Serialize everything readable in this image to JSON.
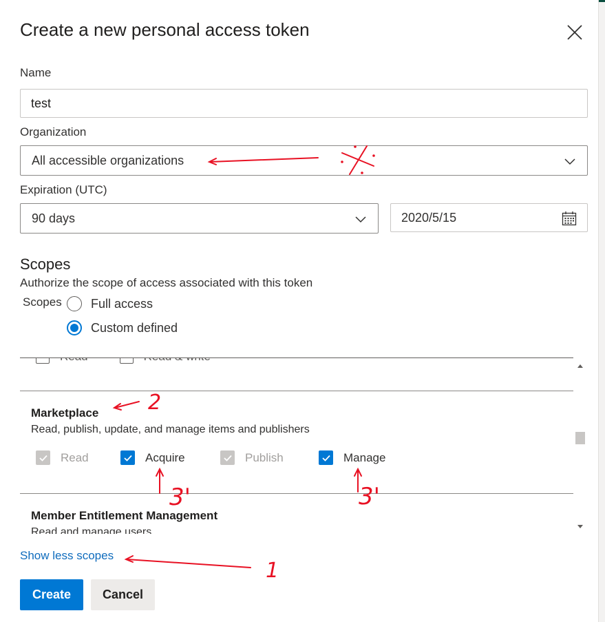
{
  "dialog": {
    "title": "Create a new personal access token"
  },
  "form": {
    "name_label": "Name",
    "name_value": "test",
    "organization_label": "Organization",
    "organization_value": "All accessible organizations",
    "expiration_label": "Expiration (UTC)",
    "expiration_value": "90 days",
    "expiration_date": "2020/5/15"
  },
  "scopes": {
    "heading": "Scopes",
    "description": "Authorize the scope of access associated with this token",
    "mini_label": "Scopes",
    "options": [
      {
        "label": "Full access",
        "selected": false
      },
      {
        "label": "Custom defined",
        "selected": true
      }
    ],
    "partial_row": [
      "Read",
      "Read & write"
    ],
    "sections": [
      {
        "title": "Marketplace",
        "description": "Read, publish, update, and manage items and publishers",
        "checkboxes": [
          {
            "label": "Read",
            "checked": true,
            "disabled": true
          },
          {
            "label": "Acquire",
            "checked": true,
            "disabled": false
          },
          {
            "label": "Publish",
            "checked": true,
            "disabled": true
          },
          {
            "label": "Manage",
            "checked": true,
            "disabled": false
          }
        ]
      },
      {
        "title": "Member Entitlement Management",
        "description": "Read and manage users"
      }
    ]
  },
  "actions": {
    "show_less_label": "Show less scopes",
    "create_label": "Create",
    "cancel_label": "Cancel"
  },
  "annotations": {
    "marks": [
      "2",
      "3'",
      "3'",
      "1"
    ]
  },
  "colors": {
    "accent": "#0078d4",
    "link": "#0f6cbd",
    "annotation": "#e81123"
  },
  "icons": [
    "close-icon",
    "chevron-down-icon",
    "calendar-icon",
    "checkmark-icon"
  ]
}
